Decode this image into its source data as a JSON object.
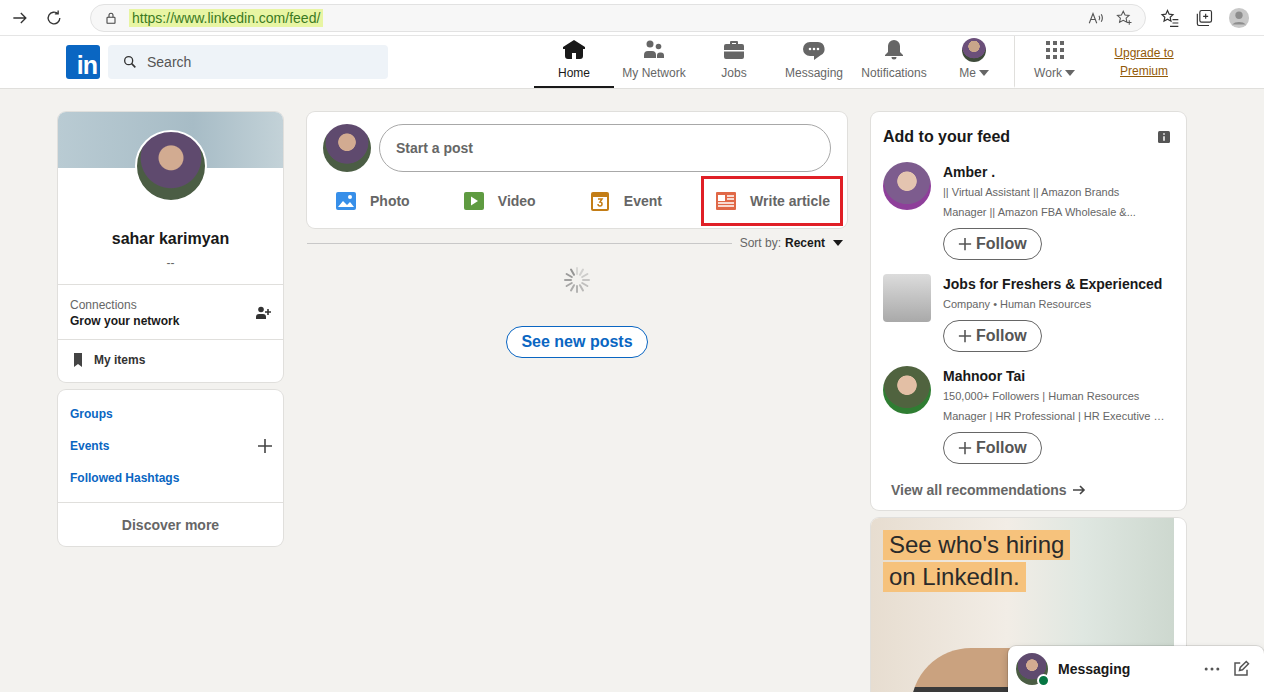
{
  "browser": {
    "url": "https://www.linkedin.com/feed/"
  },
  "nav": {
    "logo": "in",
    "search_placeholder": "Search",
    "items": [
      {
        "label": "Home",
        "kind": "home",
        "selected": true,
        "dropdown": false
      },
      {
        "label": "My Network",
        "kind": "network",
        "selected": false,
        "dropdown": false
      },
      {
        "label": "Jobs",
        "kind": "jobs",
        "selected": false,
        "dropdown": false
      },
      {
        "label": "Messaging",
        "kind": "messaging",
        "selected": false,
        "dropdown": false
      },
      {
        "label": "Notifications",
        "kind": "notifications",
        "selected": false,
        "dropdown": false
      },
      {
        "label": "Me",
        "kind": "me",
        "selected": false,
        "dropdown": true
      },
      {
        "label": "Work",
        "kind": "work",
        "selected": false,
        "dropdown": true
      }
    ],
    "premium": [
      "Upgrade to",
      "Premium"
    ]
  },
  "profile": {
    "name": "sahar karimyan",
    "headline": "--",
    "connections_label": "Connections",
    "connections_action": "Grow your network",
    "my_items": "My items"
  },
  "left_links": [
    {
      "label": "Groups",
      "add": false
    },
    {
      "label": "Events",
      "add": true
    },
    {
      "label": "Followed Hashtags",
      "add": false
    }
  ],
  "discover": "Discover more",
  "composer": {
    "placeholder": "Start a post",
    "actions": [
      {
        "label": "Photo",
        "kind": "photo",
        "color": "#378fe9",
        "highlighted": false
      },
      {
        "label": "Video",
        "kind": "video",
        "color": "#5f9b41",
        "highlighted": false
      },
      {
        "label": "Event",
        "kind": "event",
        "color": "#c37d16",
        "highlighted": false
      },
      {
        "label": "Write article",
        "kind": "article",
        "color": "#e06847",
        "highlighted": true
      }
    ]
  },
  "sort": {
    "label": "Sort by:",
    "value": "Recent"
  },
  "feed": {
    "loading": true,
    "new_posts": "See new posts"
  },
  "suggestions": {
    "title": "Add to your feed",
    "items": [
      {
        "name": "Amber .",
        "lines": [
          "|| Virtual Assistant || Amazon Brands",
          "Manager || Amazon FBA Wholesale &..."
        ],
        "follow": "Follow"
      },
      {
        "name": "Jobs for Freshers & Experienced",
        "lines": [
          "Company • Human Resources"
        ],
        "follow": "Follow"
      },
      {
        "name": "Mahnoor Tai",
        "lines": [
          "150,000+ Followers | Human Resources",
          "Manager | HR Professional | HR Executive …"
        ],
        "follow": "Follow"
      }
    ],
    "view_all": "View all recommendations"
  },
  "ad": {
    "lines": [
      "See who's hiring",
      "on LinkedIn."
    ]
  },
  "messaging": {
    "label": "Messaging",
    "online": true
  }
}
